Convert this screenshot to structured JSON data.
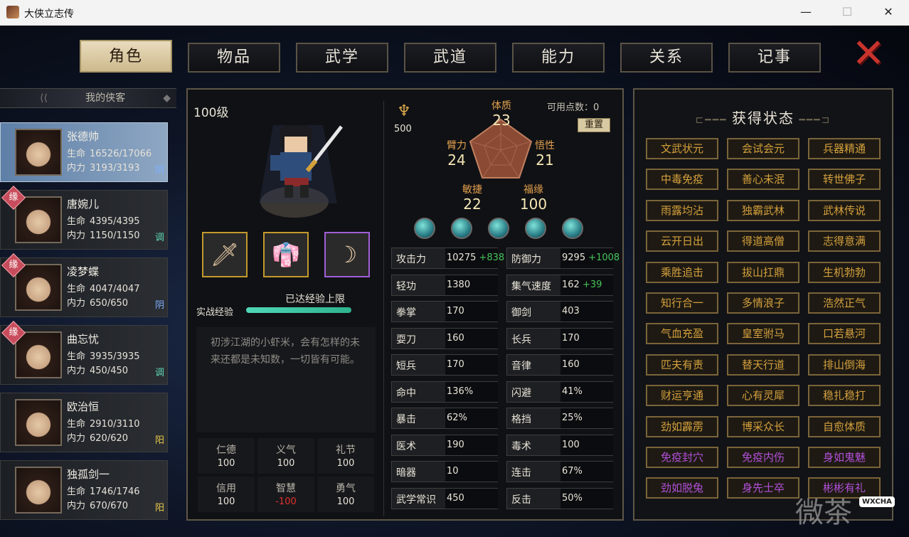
{
  "window": {
    "title": "大侠立志传",
    "minimize": "—",
    "maximize": "☐",
    "close": "✕"
  },
  "tabs": [
    {
      "label": "角色",
      "active": true
    },
    {
      "label": "物品"
    },
    {
      "label": "武学"
    },
    {
      "label": "武道",
      "badge": "!"
    },
    {
      "label": "能力"
    },
    {
      "label": "关系"
    },
    {
      "label": "记事"
    }
  ],
  "list_header": "我的侠客",
  "characters": [
    {
      "name": "张德帅",
      "hp_label": "生命",
      "hp": "16526/17066",
      "mp_label": "内力",
      "mp": "3193/3193",
      "tag": "阴",
      "tag_color": "#7fb0ff",
      "yuan": false
    },
    {
      "name": "唐婉儿",
      "hp_label": "生命",
      "hp": "4395/4395",
      "mp_label": "内力",
      "mp": "1150/1150",
      "tag": "调",
      "tag_color": "#5fd8b8",
      "yuan": true
    },
    {
      "name": "凌梦蝶",
      "hp_label": "生命",
      "hp": "4047/4047",
      "mp_label": "内力",
      "mp": "650/650",
      "tag": "阴",
      "tag_color": "#7fb0ff",
      "yuan": true
    },
    {
      "name": "曲忘忧",
      "hp_label": "生命",
      "hp": "3935/3935",
      "mp_label": "内力",
      "mp": "450/450",
      "tag": "调",
      "tag_color": "#5fd8b8",
      "yuan": true
    },
    {
      "name": "欧治恒",
      "hp_label": "生命",
      "hp": "2910/3110",
      "mp_label": "内力",
      "mp": "620/620",
      "tag": "阳",
      "tag_color": "#e8c84a",
      "yuan": false
    },
    {
      "name": "独孤剑一",
      "hp_label": "生命",
      "hp": "1746/1746",
      "mp_label": "内力",
      "mp": "670/670",
      "tag": "阳",
      "tag_color": "#e8c84a",
      "yuan": false
    }
  ],
  "yuan_label": "缘",
  "profile": {
    "level": "100级",
    "exp_label": "实战经验",
    "exp_status": "已达经验上限",
    "exp_fraction": 1.0,
    "description": "初涉江湖的小虾米，会有怎样的未来还都是未知数，一切皆有可能。",
    "virtues": [
      {
        "name": "仁德",
        "value": "100"
      },
      {
        "name": "义气",
        "value": "100"
      },
      {
        "name": "礼节",
        "value": "100"
      },
      {
        "name": "信用",
        "value": "100"
      },
      {
        "name": "智慧",
        "value": "-100",
        "negative": true
      },
      {
        "name": "勇气",
        "value": "100"
      }
    ]
  },
  "equipment": [
    {
      "icon": "dagger-icon",
      "border": "#c29a2c"
    },
    {
      "icon": "robe-icon",
      "border": "#c29a2c"
    },
    {
      "icon": "fang-necklace-icon",
      "border": "#a05fd8"
    }
  ],
  "attributes": {
    "power_value": "500",
    "points_label": "可用点数：0",
    "reset_label": "重置",
    "items": [
      {
        "name": "体质",
        "value": "23"
      },
      {
        "name": "臂力",
        "value": "24"
      },
      {
        "name": "悟性",
        "value": "21"
      },
      {
        "name": "敏捷",
        "value": "22"
      },
      {
        "name": "福缘",
        "value": "100"
      }
    ]
  },
  "stats": [
    {
      "name": "攻击力",
      "value": "10275",
      "bonus": "+838"
    },
    {
      "name": "防御力",
      "value": "9295",
      "bonus": "+1008"
    },
    {
      "name": "轻功",
      "value": "1380"
    },
    {
      "name": "集气速度",
      "value": "162",
      "bonus": "+39"
    },
    {
      "name": "拳掌",
      "value": "170"
    },
    {
      "name": "御剑",
      "value": "403"
    },
    {
      "name": "耍刀",
      "value": "160"
    },
    {
      "name": "长兵",
      "value": "170"
    },
    {
      "name": "短兵",
      "value": "170"
    },
    {
      "name": "音律",
      "value": "160"
    },
    {
      "name": "命中",
      "value": "136%"
    },
    {
      "name": "闪避",
      "value": "41%"
    },
    {
      "name": "暴击",
      "value": "62%"
    },
    {
      "name": "格挡",
      "value": "25%"
    },
    {
      "name": "医术",
      "value": "190"
    },
    {
      "name": "毒术",
      "value": "100"
    },
    {
      "name": "暗器",
      "value": "10"
    },
    {
      "name": "连击",
      "value": "67%"
    },
    {
      "name": "武学常识",
      "value": "450"
    },
    {
      "name": "反击",
      "value": "50%"
    }
  ],
  "status_panel": {
    "title": "获得状态",
    "items": [
      {
        "label": "文武状元"
      },
      {
        "label": "会试会元"
      },
      {
        "label": "兵器精通"
      },
      {
        "label": "中毒免疫"
      },
      {
        "label": "善心未泯"
      },
      {
        "label": "转世佛子"
      },
      {
        "label": "雨露均沾"
      },
      {
        "label": "独霸武林"
      },
      {
        "label": "武林传说"
      },
      {
        "label": "云开日出"
      },
      {
        "label": "得道高僧"
      },
      {
        "label": "志得意满"
      },
      {
        "label": "乘胜追击"
      },
      {
        "label": "拔山扛鼎"
      },
      {
        "label": "生机勃勃"
      },
      {
        "label": "知行合一"
      },
      {
        "label": "多情浪子"
      },
      {
        "label": "浩然正气"
      },
      {
        "label": "气血充盈"
      },
      {
        "label": "皇室驸马"
      },
      {
        "label": "口若悬河"
      },
      {
        "label": "匹夫有责"
      },
      {
        "label": "替天行道"
      },
      {
        "label": "排山倒海"
      },
      {
        "label": "财运亨通"
      },
      {
        "label": "心有灵犀"
      },
      {
        "label": "稳扎稳打"
      },
      {
        "label": "劲如霹雳"
      },
      {
        "label": "博采众长"
      },
      {
        "label": "自愈体质"
      },
      {
        "label": "免疫封穴",
        "purple": true
      },
      {
        "label": "免疫内伤",
        "purple": true
      },
      {
        "label": "身如鬼魅",
        "purple": true
      },
      {
        "label": "劲如脱兔",
        "purple": true
      },
      {
        "label": "身先士卒",
        "purple": true
      },
      {
        "label": "彬彬有礼",
        "purple": true
      }
    ]
  },
  "watermark": {
    "text": "微茶",
    "badge": "WXCHA"
  }
}
